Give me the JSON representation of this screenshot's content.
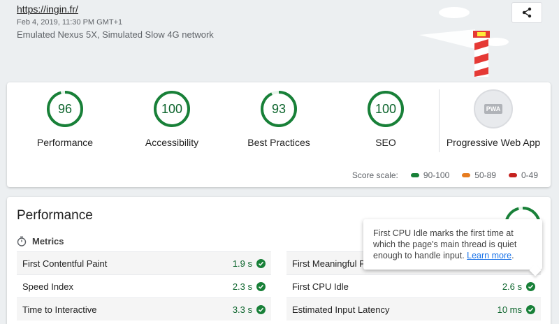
{
  "header": {
    "url": "https://ingin.fr/",
    "date": "Feb 4, 2019, 11:30 PM GMT+1",
    "environment": "Emulated Nexus 5X, Simulated Slow 4G network",
    "share_icon": "share-icon"
  },
  "scores": [
    {
      "label": "Performance",
      "value": "96",
      "fraction": 0.96
    },
    {
      "label": "Accessibility",
      "value": "100",
      "fraction": 1.0
    },
    {
      "label": "Best Practices",
      "value": "93",
      "fraction": 0.93
    },
    {
      "label": "SEO",
      "value": "100",
      "fraction": 1.0
    }
  ],
  "pwa": {
    "label": "Progressive Web App",
    "badge": "PWA"
  },
  "scale": {
    "label": "Score scale:",
    "items": [
      {
        "label": "90-100",
        "color": "#188038"
      },
      {
        "label": "50-89",
        "color": "#e67c1f"
      },
      {
        "label": "0-49",
        "color": "#c5221f"
      }
    ]
  },
  "performance": {
    "title": "Performance",
    "metrics_label": "Metrics",
    "left": [
      {
        "name": "First Contentful Paint",
        "value": "1.9 s"
      },
      {
        "name": "Speed Index",
        "value": "2.3 s"
      },
      {
        "name": "Time to Interactive",
        "value": "3.3 s"
      }
    ],
    "right": [
      {
        "name": "First Meaningful P",
        "value": ""
      },
      {
        "name": "First CPU Idle",
        "value": "2.6 s"
      },
      {
        "name": "Estimated Input Latency",
        "value": "10 ms"
      }
    ]
  },
  "tooltip": {
    "text": "First CPU Idle marks the first time at which the page's main thread is quiet enough to handle input. ",
    "link": "Learn more",
    "suffix": "."
  },
  "colors": {
    "pass": "#188038",
    "pass_text": "#0d652d"
  }
}
